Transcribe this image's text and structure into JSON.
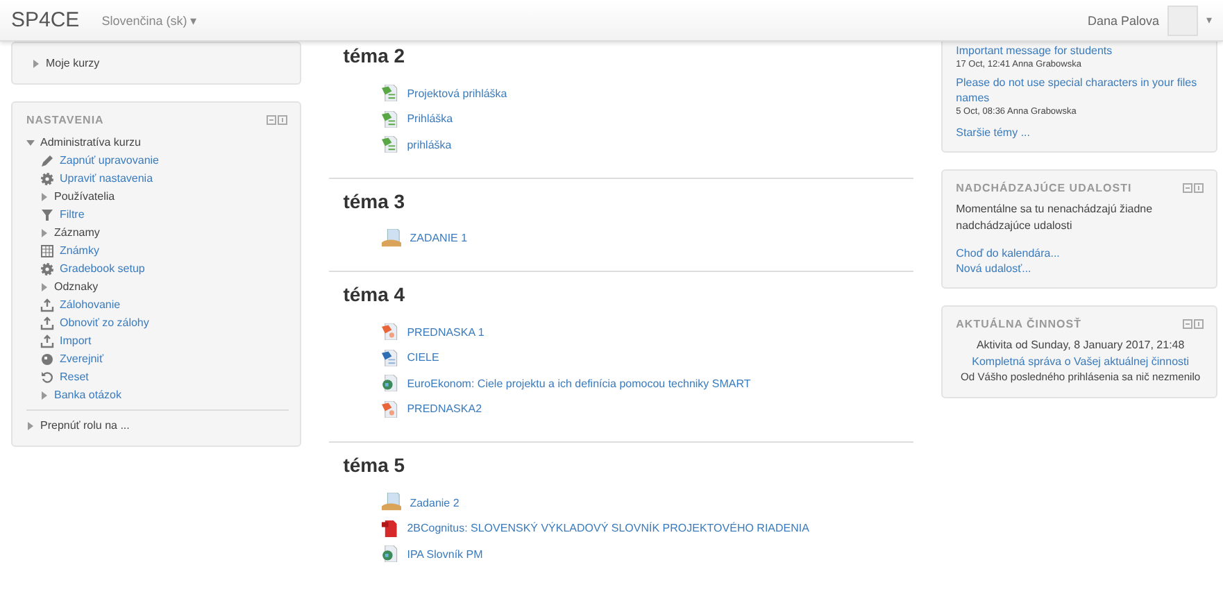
{
  "navbar": {
    "brand": "SP4CE",
    "language": "Slovenčina (sk) ▾",
    "user": "Dana Palova",
    "user_caret": "▾"
  },
  "left": {
    "my_courses": {
      "label": "Moje kurzy",
      "expanded": false
    },
    "settings": {
      "title": "NASTAVENIA",
      "root": {
        "label": "Administratíva kurzu",
        "expanded": true,
        "children": [
          {
            "kind": "pencil",
            "label": "Zapnúť upravovanie"
          },
          {
            "kind": "gear",
            "label": "Upraviť nastavenia"
          },
          {
            "kind": "branch",
            "label": "Používatelia",
            "expanded": false
          },
          {
            "kind": "filter",
            "label": "Filtre"
          },
          {
            "kind": "branch",
            "label": "Záznamy",
            "expanded": false
          },
          {
            "kind": "grades",
            "label": "Známky"
          },
          {
            "kind": "gear",
            "label": "Gradebook setup"
          },
          {
            "kind": "branch",
            "label": "Odznaky",
            "expanded": false
          },
          {
            "kind": "upload",
            "label": "Zálohovanie"
          },
          {
            "kind": "upload",
            "label": "Obnoviť zo zálohy"
          },
          {
            "kind": "upload",
            "label": "Import"
          },
          {
            "kind": "publish",
            "label": "Zverejniť"
          },
          {
            "kind": "reset",
            "label": "Reset"
          },
          {
            "kind": "link-branch",
            "label": "Banka otázok",
            "expanded": false
          }
        ]
      },
      "switch_role": {
        "label": "Prepnúť rolu na ...",
        "expanded": false
      }
    }
  },
  "sections": [
    {
      "title": "téma 2",
      "activities": [
        {
          "kind": "sheet",
          "label": "Projektová prihláška"
        },
        {
          "kind": "sheet",
          "label": "Prihláška"
        },
        {
          "kind": "sheet",
          "label": "prihláška"
        }
      ]
    },
    {
      "title": "téma 3",
      "activities": [
        {
          "kind": "assignment",
          "label": "ZADANIE 1"
        }
      ]
    },
    {
      "title": "téma 4",
      "activities": [
        {
          "kind": "slides",
          "label": "PREDNASKA 1"
        },
        {
          "kind": "doc",
          "label": "CIELE"
        },
        {
          "kind": "url",
          "label": "EuroEkonom: Ciele projektu a ich definícia pomocou techniky SMART"
        },
        {
          "kind": "slides",
          "label": "PREDNASKA2"
        }
      ]
    },
    {
      "title": "téma 5",
      "activities": [
        {
          "kind": "assignment",
          "label": "Zadanie 2"
        },
        {
          "kind": "pdf",
          "label": "2BCognitus: SLOVENSKÝ VÝKLADOVÝ SLOVNÍK PROJEKTOVÉHO RIADENIA"
        },
        {
          "kind": "url",
          "label": "IPA Slovník PM"
        }
      ]
    }
  ],
  "right": {
    "news": {
      "posts": [
        {
          "title": "Important message for students",
          "meta": "17 Oct, 12:41  Anna Grabowska"
        },
        {
          "title": "Please do not use special characters in your files names",
          "meta": "5 Oct, 08:36  Anna Grabowska"
        }
      ],
      "older": "Staršie témy ..."
    },
    "events": {
      "title": "NADCHÁDZAJÚCE UDALOSTI",
      "text": "Momentálne sa tu nenachádzajú žiadne nadchádzajúce udalosti",
      "links": [
        "Choď do kalendára...",
        "Nová udalosť..."
      ]
    },
    "activity": {
      "title": "AKTUÁLNA ČINNOSŤ",
      "since": "Aktivita od Sunday, 8 January 2017, 21:48",
      "report": "Kompletná správa o Vašej aktuálnej činnosti",
      "none": "Od Vášho posledného prihlásenia sa nič nezmenilo"
    }
  }
}
